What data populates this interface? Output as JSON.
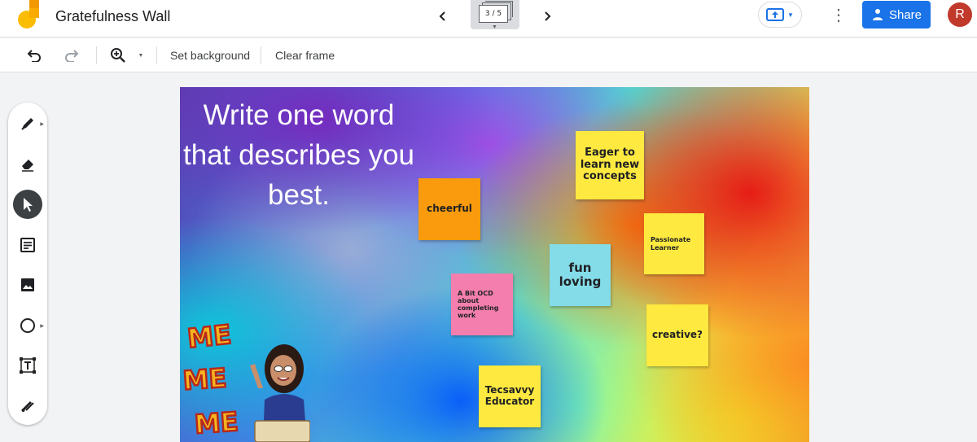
{
  "app": {
    "title": "Gratefulness Wall"
  },
  "frames": {
    "indicator": "3 / 5"
  },
  "header": {
    "share_label": "Share",
    "avatar_initial": "R"
  },
  "toolbar": {
    "set_background": "Set background",
    "clear_frame": "Clear frame"
  },
  "canvas": {
    "title": "Write one word that describes you best.",
    "notes": [
      {
        "text": "Eager to learn new concepts",
        "color": "#fde93f"
      },
      {
        "text": "cheerful",
        "color": "#f99b0c"
      },
      {
        "text": "Passionate Learner",
        "color": "#fde93f"
      },
      {
        "text": "fun loving",
        "color": "#84dce8"
      },
      {
        "text": "A Bit OCD about completing work",
        "color": "#f47fae"
      },
      {
        "text": "creative?",
        "color": "#fde93f"
      },
      {
        "text": "Tecsavvy Educator",
        "color": "#fde93f"
      }
    ],
    "sticker": {
      "words": [
        "ME",
        "ME",
        "ME"
      ]
    }
  },
  "colors": {
    "accent": "#1a73e8",
    "avatar": "#c0392b"
  },
  "tools": [
    "pen-icon",
    "eraser-icon",
    "select-icon",
    "sticky-note-icon",
    "image-icon",
    "circle-icon",
    "text-box-icon",
    "laser-icon"
  ]
}
